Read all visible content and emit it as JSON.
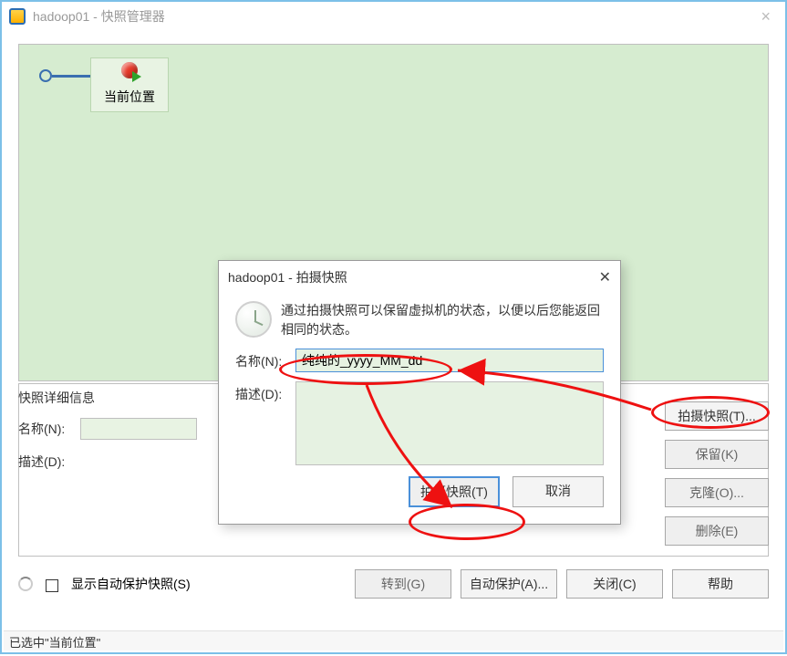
{
  "window": {
    "title": "hadoop01 - 快照管理器"
  },
  "tree": {
    "current_label": "当前位置"
  },
  "details": {
    "title": "快照详细信息",
    "name_label": "名称(N):",
    "desc_label": "描述(D):"
  },
  "right_buttons": {
    "take": "拍摄快照(T)...",
    "keep": "保留(K)",
    "clone": "克隆(O)...",
    "delete": "删除(E)"
  },
  "bottom": {
    "show_auto": "显示自动保护快照(S)",
    "goto": "转到(G)",
    "auto": "自动保护(A)...",
    "close": "关闭(C)",
    "help": "帮助"
  },
  "status": "已选中\"当前位置\"",
  "dialog": {
    "title": "hadoop01 - 拍摄快照",
    "info": "通过拍摄快照可以保留虚拟机的状态，以便以后您能返回相同的状态。",
    "name_label": "名称(N):",
    "name_value": "纯纯的_yyyy_MM_dd",
    "desc_label": "描述(D):",
    "desc_value": "",
    "ok": "拍摄快照(T)",
    "cancel": "取消"
  }
}
